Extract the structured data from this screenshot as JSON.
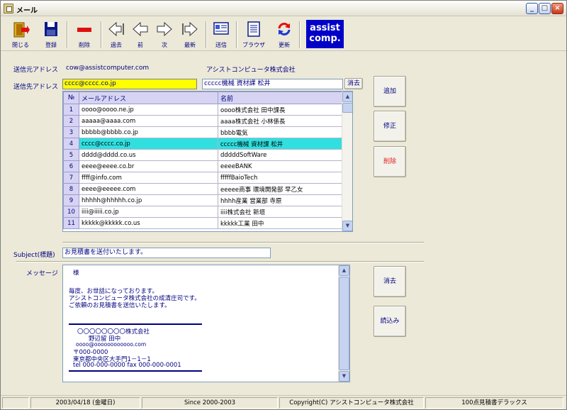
{
  "window": {
    "title": "メール"
  },
  "toolbar": {
    "close": "閉じる",
    "register": "登録",
    "delete": "削除",
    "past": "過去",
    "prev": "前",
    "next": "次",
    "latest": "最新",
    "send": "送信",
    "browser": "ブラウザ",
    "refresh": "更新",
    "logo_line1": "assist",
    "logo_line2": "comp."
  },
  "sender": {
    "label": "送信元アドレス",
    "email": "cow@assistcomputer.com",
    "company": "アシストコンピュータ株式会社"
  },
  "recipient": {
    "label": "送信先アドレス",
    "email": "cccc@cccc.co.jp",
    "name": "ccccc機械 資材課 松井",
    "clear_button": "消去"
  },
  "address_table": {
    "headers": [
      "№",
      "メールアドレス",
      "名前"
    ],
    "rows": [
      {
        "no": "1",
        "email": "oooo@oooo.ne.jp",
        "name": "oooo株式会社 田中課長"
      },
      {
        "no": "2",
        "email": "aaaaa@aaaa.com",
        "name": "aaaa株式会社 小林係長"
      },
      {
        "no": "3",
        "email": "bbbbb@bbbb.co.jp",
        "name": "bbbb電気"
      },
      {
        "no": "4",
        "email": "cccc@cccc.co.jp",
        "name": "ccccc機械 資材課 松井"
      },
      {
        "no": "5",
        "email": "dddd@dddd.co.us",
        "name": "dddddSoftWare"
      },
      {
        "no": "6",
        "email": "eeee@eeee.co.br",
        "name": "eeeeBANK"
      },
      {
        "no": "7",
        "email": "ffff@info.com",
        "name": "fffffBaioTech"
      },
      {
        "no": "8",
        "email": "eeee@eeeee.com",
        "name": "eeeee商事 環境開発部 早乙女"
      },
      {
        "no": "9",
        "email": "hhhhh@hhhhh.co.jp",
        "name": "hhhh産業 営業部 寺原"
      },
      {
        "no": "10",
        "email": "iiii@iiiii.co.jp",
        "name": "iiii株式会社 新垣"
      },
      {
        "no": "11",
        "email": "kkkkk@kkkkk.co.us",
        "name": "kkkkk工業 田中"
      }
    ],
    "selected_row": "4"
  },
  "side_buttons": {
    "add": "追加",
    "edit": "修正",
    "delete": "削除",
    "clear": "消去",
    "load": "読込み"
  },
  "subject": {
    "label": "Subject(標題)",
    "value": "お見積書を送付いたします。"
  },
  "message": {
    "label": "メッセージ",
    "lines": [
      "様",
      "毎度、お世話になっております。",
      "アシストコンピュータ株式会社の成清庄司です。",
      "ご依頼のお見積書を送信いたします。"
    ],
    "signature": [
      "〇〇〇〇〇〇〇〇株式会社",
      "野辺留 田中",
      "oooo@oooooooooooo.com",
      "〒000-0000",
      "東京都中央区大手門1－1－1",
      "tel 000-000-0000 fax 000-000-0001"
    ]
  },
  "status": {
    "date": "2003/04/18 (金曜日)",
    "since": "Since 2000-2003",
    "copyright": "Copyright(C) アシストコンピュータ株式会社",
    "product": "100点見積書デラックス"
  },
  "colors": {
    "accent_navy": "#000080",
    "selected_row": "#30e0e0",
    "recipient_highlight": "#ffff00",
    "logo_bg": "#0000c8"
  }
}
